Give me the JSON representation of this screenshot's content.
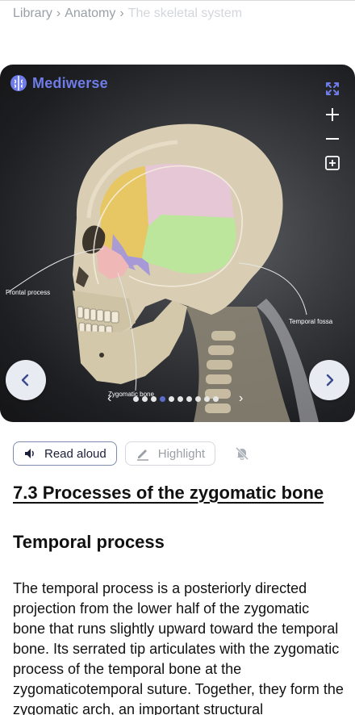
{
  "breadcrumb": {
    "items": [
      "Library",
      "Anatomy"
    ],
    "separator": "›",
    "current": "The skeletal system"
  },
  "viewer": {
    "brand": "Mediwerse",
    "labels": {
      "frontal_process": "Frontal process",
      "temporal_fossa": "Temporal fossa",
      "zygomatic_bone": "Zygomatic bone"
    },
    "slides": {
      "total": 10,
      "active": 3
    },
    "tools": [
      "expand-icon",
      "zoom-in-icon",
      "zoom-out-icon",
      "fit-zoom-icon"
    ]
  },
  "toolbar": {
    "read_aloud": "Read aloud",
    "highlight": "Highlight"
  },
  "content": {
    "section_title": "7.3 Processes of the zygomatic bone",
    "subsection_title": "Temporal process",
    "paragraph": "The temporal process is a posteriorly directed projection from the lower half of the zygomatic bone that runs slightly upward toward the temporal bone. Its serrated tip articulates with the zygomatic process of the temporal bone at the zygomaticotemporal suture. Together, they form the zygomatic arch, an important structural"
  },
  "colors": {
    "brand": "#6f7ce8",
    "frontal_region": "#e8c75a",
    "parietal_region": "#e7c6d8",
    "temporal_region": "#b9e89a",
    "sphenoid_region": "#a799d8",
    "zygomatic_region": "#f0b7b7",
    "bone": "#d9ceb4"
  }
}
